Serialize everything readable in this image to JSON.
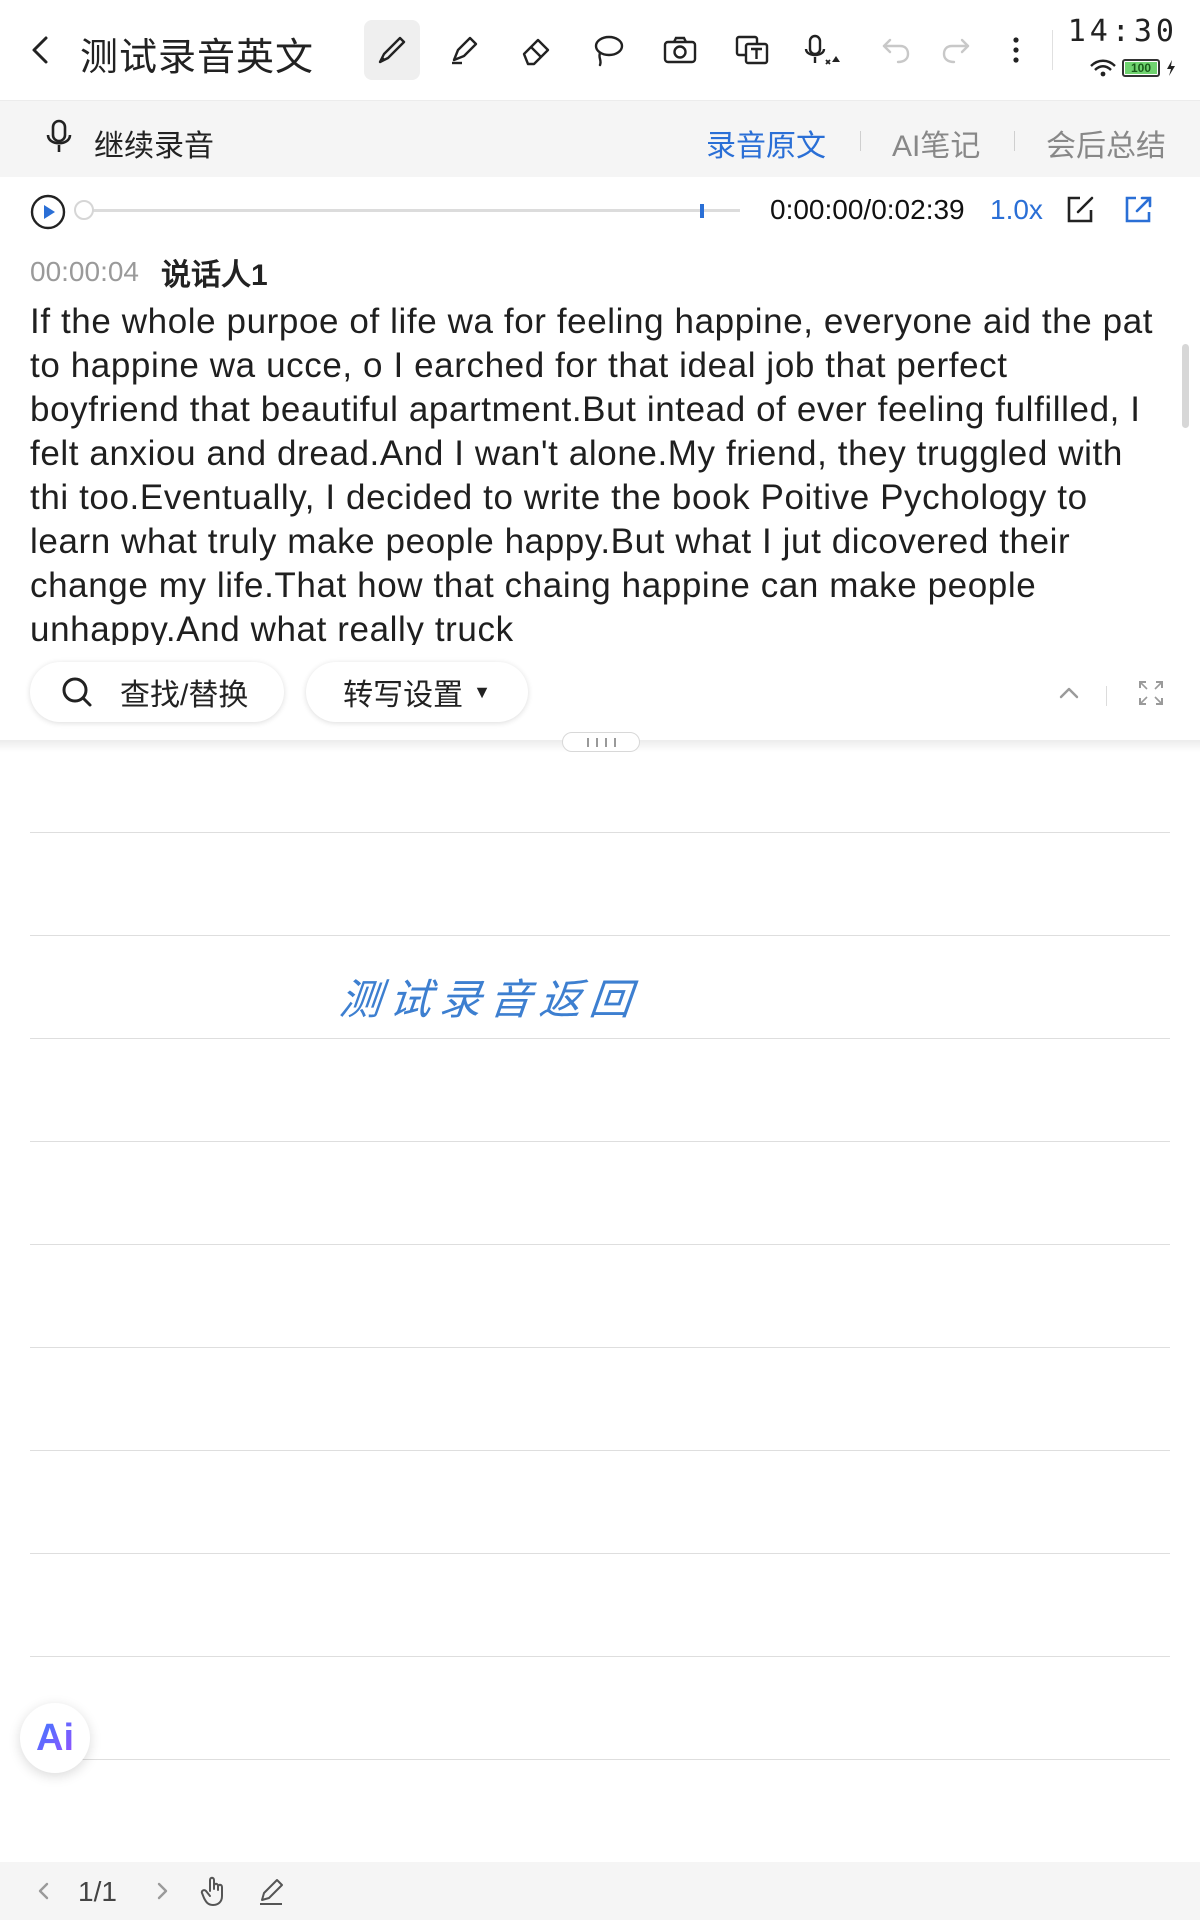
{
  "header": {
    "title": "测试录音英文",
    "tools": [
      "brush-icon",
      "highlighter-icon",
      "eraser-icon",
      "lasso-icon",
      "camera-icon",
      "text-recognize-icon",
      "mic-settings-icon",
      "undo-icon",
      "redo-icon",
      "more-icon"
    ]
  },
  "status": {
    "time": "14:30",
    "battery": "100"
  },
  "subbar": {
    "continue_recording": "继续录音",
    "tabs": [
      "录音原文",
      "AI笔记",
      "会后总结"
    ],
    "active_tab": "录音原文"
  },
  "player": {
    "time": "0:00:00/0:02:39",
    "speed": "1.0x",
    "progress": 0
  },
  "transcript": {
    "timestamp": "00:00:04",
    "speaker": "说话人1",
    "text": "If the whole purpoe of life wa for feeling happine, everyone aid the pat to happine wa ucce, o I earched for that ideal job that perfect boyfriend that beautiful apartment.But intead of ever feeling fulfilled, I felt anxiou and dread.And I wan't alone.My friend, they truggled with thi too.Eventually, I decided to write the book Poitive Pychology to learn what truly make people happy.But what I jut dicovered their change my life.That how that chaing happine can make people unhappy.And what really truck"
  },
  "toolrow": {
    "search_label": "查找/替换",
    "settings_label": "转写设置"
  },
  "note": {
    "handwriting": "测试录音返回"
  },
  "ai_button": "Ai",
  "footer": {
    "page": "1/1"
  },
  "colors": {
    "accent": "#2a6fd6",
    "handwriting": "#3d7fd0"
  }
}
